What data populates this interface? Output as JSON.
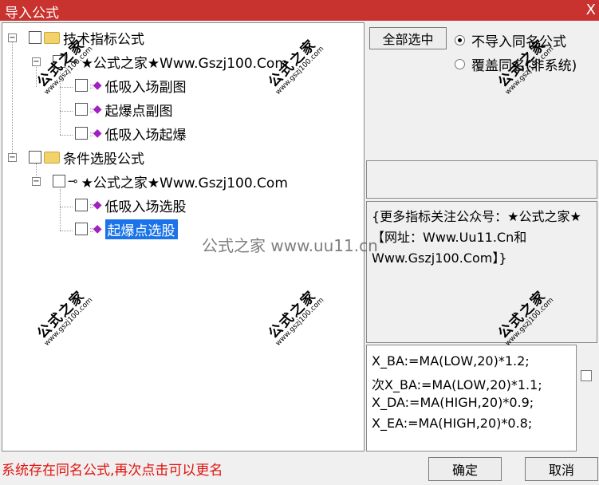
{
  "window": {
    "title": "导入公式",
    "close_glyph": "X"
  },
  "tree": {
    "folder1": {
      "label": "技术指标公式"
    },
    "group1": {
      "label": "★公式之家★Www.Gszj100.Com"
    },
    "items1": [
      "低吸入场副图",
      "起爆点副图",
      "低吸入场起爆"
    ],
    "folder2": {
      "label": "条件选股公式"
    },
    "group2": {
      "label": "★公式之家★Www.Gszj100.Com"
    },
    "items2": [
      "低吸入场选股",
      "起爆点选股"
    ],
    "selected_item": "起爆点选股"
  },
  "options": {
    "select_all_label": "全部选中",
    "radio_skip_label": "不导入同名公式",
    "radio_overwrite_label": "覆盖同名(非系统)",
    "selected_radio": "radio_skip"
  },
  "description": "{更多指标关注公众号：★公式之家★ 【网址：Www.Uu11.Cn和Www.Gszj100.Com】}",
  "code": [
    "X_BA:=MA(LOW,20)*1.2;",
    "次X_BA:=MA(LOW,20)*1.1;",
    "X_DA:=MA(HIGH,20)*0.9;",
    "X_EA:=MA(HIGH,20)*0.8;"
  ],
  "status_message": "系统存在同名公式,再次点击可以更名",
  "buttons": {
    "ok": "确定",
    "cancel": "取消"
  },
  "watermark": {
    "big": "公式之家",
    "small": "www.gszj100.com",
    "center": "公式之家 www.uu11.cn"
  }
}
